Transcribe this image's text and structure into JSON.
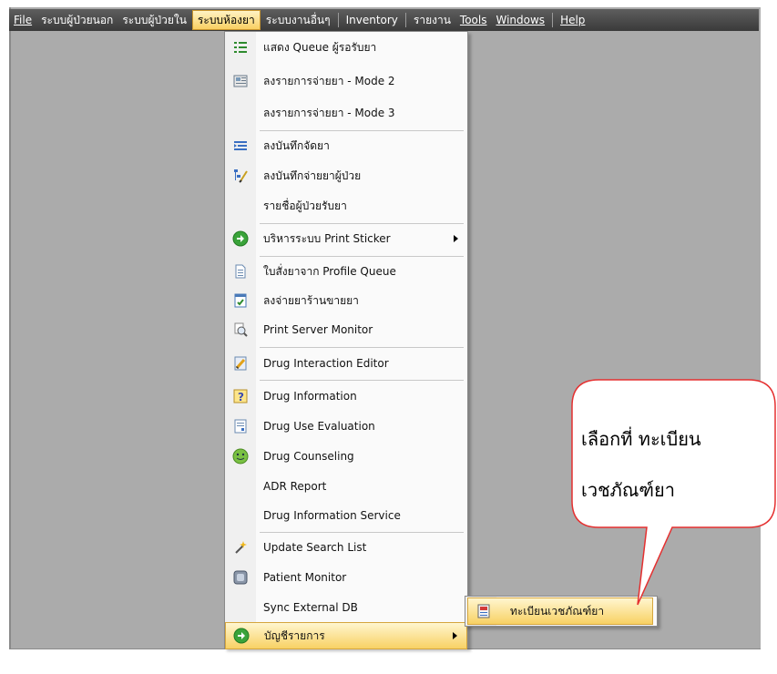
{
  "menubar": {
    "items": [
      {
        "label": "File",
        "accel": "F"
      },
      {
        "label": "ระบบผู้ป่วยนอก"
      },
      {
        "label": "ระบบผู้ป่วยใน"
      },
      {
        "label": "ระบบห้องยา"
      },
      {
        "label": "ระบบงานอื่นๆ"
      },
      {
        "label": "Inventory"
      },
      {
        "label": "รายงาน"
      },
      {
        "label": "Tools"
      },
      {
        "label": "Windows"
      },
      {
        "label": "Help"
      }
    ],
    "active_index": 3
  },
  "menu": {
    "items": [
      {
        "label": "แสดง Queue ผู้รอรับยา",
        "icon": "list-icon"
      },
      {
        "label": "ลงรายการจ่ายยา - Mode 2",
        "icon": "form-icon"
      },
      {
        "label": "ลงรายการจ่ายยา - Mode 3",
        "icon": ""
      },
      {
        "label": "ลงบันทึกจัดยา",
        "icon": "indent-list-icon"
      },
      {
        "label": "ลงบันทึกจ่ายยาผู้ป่วย",
        "icon": "edit-tree-icon"
      },
      {
        "label": "รายชื่อผู้ป่วยรับยา",
        "icon": ""
      },
      {
        "label": "บริหารระบบ Print Sticker",
        "icon": "green-arrow-icon",
        "submenu": true
      },
      {
        "label": "ใบสั่งยาจาก Profile Queue",
        "icon": "document-icon"
      },
      {
        "label": "ลงจ่ายยาร้านขายยา",
        "icon": "checklist-icon"
      },
      {
        "label": "Print Server Monitor",
        "icon": "magnifier-icon"
      },
      {
        "label": "Drug Interaction Editor",
        "icon": "pencil-doc-icon"
      },
      {
        "label": "Drug Information",
        "icon": "help-icon"
      },
      {
        "label": "Drug Use Evaluation",
        "icon": "report-icon"
      },
      {
        "label": "Drug Counseling",
        "icon": "smiley-icon"
      },
      {
        "label": "ADR Report",
        "icon": ""
      },
      {
        "label": "Drug Information Service",
        "icon": ""
      },
      {
        "label": "Update Search List",
        "icon": "magic-wand-icon"
      },
      {
        "label": "Patient Monitor",
        "icon": "monitor-icon"
      },
      {
        "label": "Sync External DB",
        "icon": ""
      },
      {
        "label": "บัญชีรายการ",
        "icon": "green-arrow-icon",
        "submenu": true,
        "highlighted": true
      }
    ]
  },
  "submenu": {
    "items": [
      {
        "label": "ทะเบียนเวชภัณฑ์ยา",
        "icon": "register-icon",
        "highlighted": true
      }
    ]
  },
  "callout": {
    "line1": "เลือกที่ ทะเบียน",
    "line2": "เวชภัณฑ์ยา",
    "border_color": "#e53030"
  }
}
